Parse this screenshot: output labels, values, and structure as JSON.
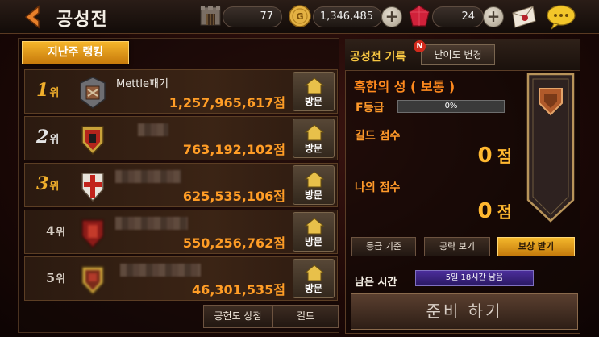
{
  "header": {
    "title": "공성전",
    "resources": [
      {
        "icon": "castle-gate-icon",
        "value": "77"
      },
      {
        "icon": "gold-coin-icon",
        "value": "1,346,485"
      },
      {
        "icon": "ruby-gem-icon",
        "value": "24"
      }
    ]
  },
  "left": {
    "tab_label": "지난주 랭킹",
    "rank_suffix": "위",
    "visit_label": "방문",
    "rows": [
      {
        "rank": "1",
        "name": "Mettle패기",
        "score": "1,257,965,617점"
      },
      {
        "rank": "2",
        "name": "",
        "score": "763,192,102점"
      },
      {
        "rank": "3",
        "name": "",
        "score": "625,535,106점"
      },
      {
        "rank": "4",
        "name": "",
        "score": "550,256,762점"
      },
      {
        "rank": "5",
        "name": "",
        "score": "46,301,535점"
      }
    ],
    "buttons": {
      "shop": "공헌도 상점",
      "guild": "길드"
    }
  },
  "right": {
    "title": "공성전 기록",
    "badge": "N",
    "difficulty_button": "난이도 변경",
    "castle_name": "혹한의 성 ( 보통 )",
    "grade": "F등급",
    "progress": {
      "percent_text": "0%",
      "value": 0
    },
    "guild_score_label": "길드 점수",
    "guild_score": "0",
    "my_score_label": "나의 점수",
    "my_score": "0",
    "score_unit": "점",
    "buttons": {
      "grade_criteria": "등급 기준",
      "strategy": "공략 보기",
      "reward": "보상 받기"
    },
    "remaining_label": "남은 시간",
    "remaining_value": "5일 18시간 남음",
    "ready_button": "준비 하기"
  },
  "colors": {
    "accent": "#f2b02c",
    "score": "#ff9d26",
    "remain": "#4b2e9a"
  }
}
